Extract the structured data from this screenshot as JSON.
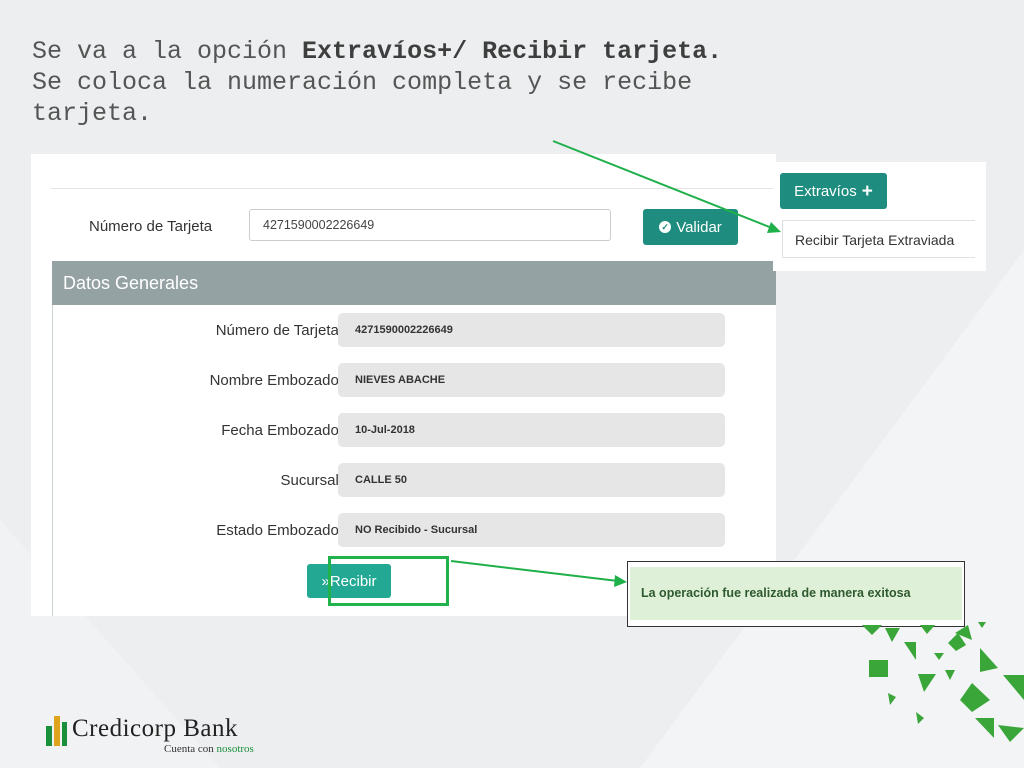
{
  "instructions": {
    "line1_prefix": "Se va a la opción ",
    "line1_bold": "Extravíos+/ Recibir tarjeta.",
    "line2": "Se coloca la numeración completa y se recibe",
    "line3": "tarjeta."
  },
  "search": {
    "label": "Número de Tarjeta",
    "value": "4271590002226649",
    "validate_label": "Validar"
  },
  "datos_generales": {
    "title": "Datos Generales",
    "fields": [
      {
        "label": "Número de Tarjeta:",
        "value": "4271590002226649"
      },
      {
        "label": "Nombre Embozado:",
        "value": "NIEVES ABACHE"
      },
      {
        "label": "Fecha Embozado:",
        "value": "10-Jul-2018"
      },
      {
        "label": "Sucursal:",
        "value": "CALLE 50"
      },
      {
        "label": "Estado Embozado:",
        "value": "NO Recibido - Sucursal"
      }
    ],
    "receive_label": "»Recibir"
  },
  "extravios_menu": {
    "button_label": "Extravíos",
    "items": [
      "Recibir Tarjeta Extraviada"
    ]
  },
  "success_message": "La operación fue realizada de manera exitosa",
  "branding": {
    "name": "Credicorp Bank",
    "tagline_prefix": "Cuenta con ",
    "tagline_highlight": "nosotros"
  },
  "colors": {
    "primary_button": "#1e8c7e",
    "recibir_button": "#23a893",
    "highlight_green": "#22b24c",
    "header_gray": "#95a2a4",
    "success_bg": "#dff0d8"
  }
}
